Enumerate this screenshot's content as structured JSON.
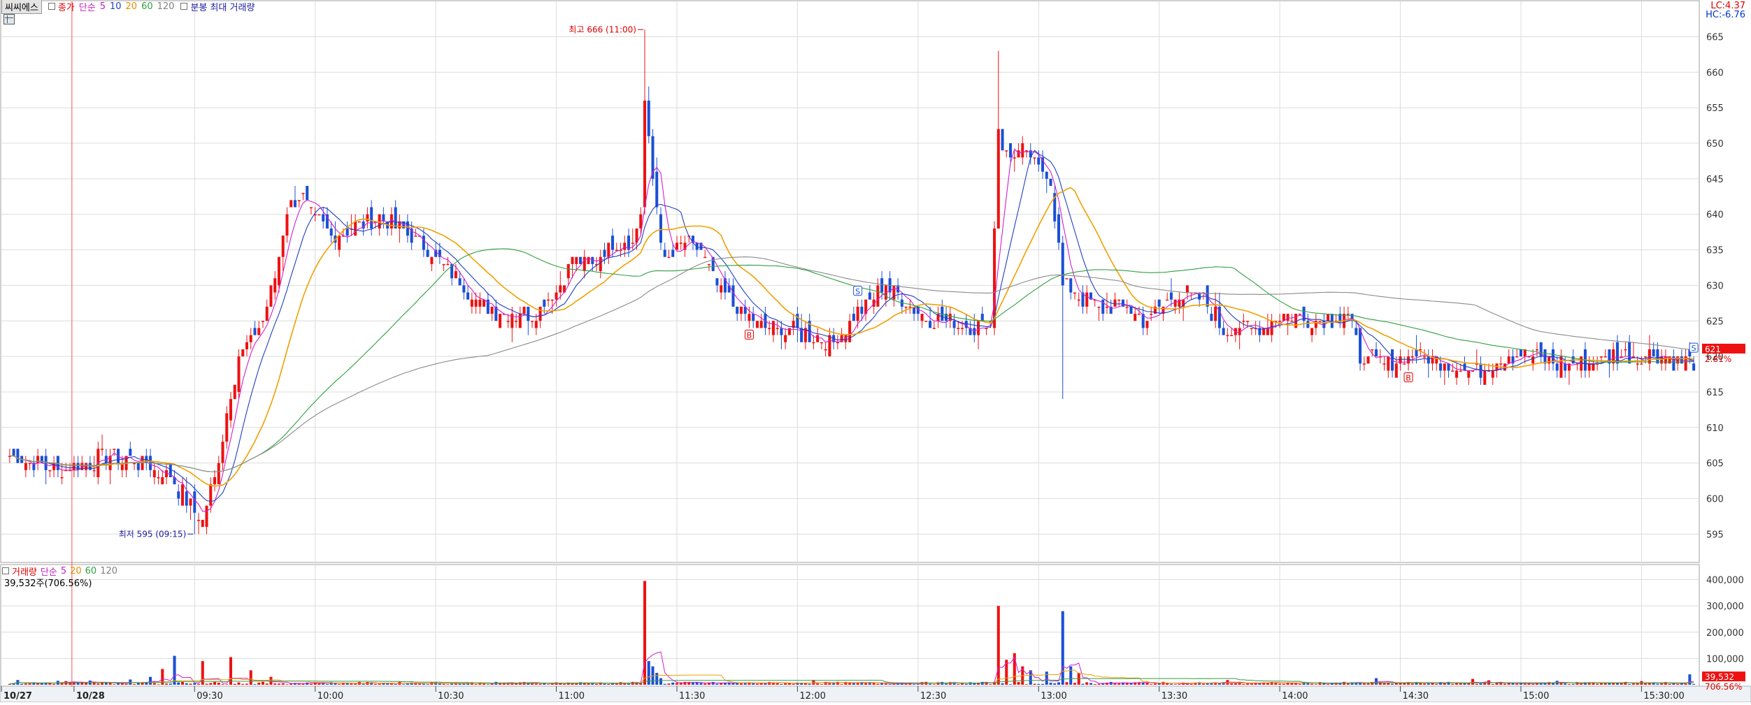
{
  "legend": {
    "stock_name": "씨씨에스",
    "price_label": "종가",
    "ma_type": "단순",
    "ma_periods": [
      "5",
      "10",
      "20",
      "60",
      "120"
    ],
    "extra": "분봉 최대 거래량"
  },
  "volume_legend": {
    "label": "거래량",
    "ma_type": "단순",
    "ma_periods": [
      "5",
      "20",
      "60",
      "120"
    ],
    "readout": "39,532주(706.56%)"
  },
  "corner": {
    "lc": "LC:4.37",
    "hc": "HC:-6.76"
  },
  "price_tag": {
    "value": "621",
    "pct": "2.81%"
  },
  "volume_tag": {
    "value": "39,532",
    "pct": "706.56%"
  },
  "annotations": {
    "high": "최고 666 (11:00)",
    "low": "최저 595 (09:15)"
  },
  "markers": {
    "buy": "B",
    "sell": "S"
  },
  "colors": {
    "up": "#ee1111",
    "down": "#1a4fd6",
    "ma5": "#d020d0",
    "ma10": "#2040c0",
    "ma20": "#f0a000",
    "ma60": "#30a040",
    "ma120": "#8a8a8a",
    "grid": "#dcdcdc"
  },
  "chart_data": {
    "type": "candlestick",
    "x_ticks": [
      "10/27",
      "10/28",
      "09:30",
      "10:00",
      "10:30",
      "11:00",
      "11:30",
      "12:00",
      "12:30",
      "13:00",
      "13:30",
      "14:00",
      "14:30",
      "15:00",
      "15:30:00"
    ],
    "price_axis": {
      "ylim": [
        591,
        668
      ],
      "ticks": [
        595,
        600,
        605,
        610,
        615,
        620,
        625,
        630,
        635,
        640,
        645,
        650,
        655,
        660,
        665
      ]
    },
    "volume_axis": {
      "ylim": [
        0,
        420000
      ],
      "ticks": [
        "100,000",
        "200,000",
        "300,000",
        "400,000"
      ]
    },
    "price_anchors": [
      [
        0,
        606
      ],
      [
        12,
        604
      ],
      [
        25,
        606
      ],
      [
        33,
        605
      ],
      [
        40,
        603
      ],
      [
        46,
        598
      ],
      [
        48,
        597
      ],
      [
        51,
        603
      ],
      [
        54,
        612
      ],
      [
        57,
        620
      ],
      [
        60,
        622
      ],
      [
        63,
        625
      ],
      [
        66,
        631
      ],
      [
        69,
        641
      ],
      [
        72,
        643
      ],
      [
        75,
        640
      ],
      [
        80,
        637
      ],
      [
        85,
        638
      ],
      [
        92,
        640
      ],
      [
        100,
        637
      ],
      [
        110,
        632
      ],
      [
        118,
        627
      ],
      [
        125,
        626
      ],
      [
        130,
        626
      ],
      [
        136,
        629
      ],
      [
        140,
        634
      ],
      [
        145,
        633
      ],
      [
        150,
        636
      ],
      [
        155,
        636
      ],
      [
        157,
        640
      ],
      [
        158,
        656
      ],
      [
        160,
        645
      ],
      [
        163,
        633
      ],
      [
        168,
        636
      ],
      [
        172,
        635
      ],
      [
        176,
        630
      ],
      [
        180,
        627
      ],
      [
        185,
        625
      ],
      [
        190,
        624
      ],
      [
        200,
        623
      ],
      [
        205,
        622
      ],
      [
        209,
        625
      ],
      [
        213,
        627
      ],
      [
        218,
        630
      ],
      [
        222,
        628
      ],
      [
        226,
        626
      ],
      [
        232,
        625
      ],
      [
        240,
        624
      ],
      [
        244,
        625
      ],
      [
        246,
        652
      ],
      [
        248,
        648
      ],
      [
        251,
        649
      ],
      [
        254,
        648
      ],
      [
        257,
        646
      ],
      [
        259,
        645
      ],
      [
        262,
        630
      ],
      [
        265,
        629
      ],
      [
        270,
        627
      ],
      [
        278,
        627
      ],
      [
        283,
        625
      ],
      [
        290,
        629
      ],
      [
        297,
        628
      ],
      [
        302,
        624
      ],
      [
        312,
        624
      ],
      [
        318,
        626
      ],
      [
        326,
        625
      ],
      [
        333,
        626
      ],
      [
        336,
        620
      ],
      [
        342,
        619
      ],
      [
        350,
        620
      ],
      [
        358,
        619
      ],
      [
        365,
        618
      ],
      [
        372,
        620
      ],
      [
        380,
        620
      ],
      [
        385,
        619
      ],
      [
        390,
        619
      ],
      [
        398,
        620
      ],
      [
        405,
        620
      ],
      [
        410,
        620
      ],
      [
        419,
        619
      ]
    ],
    "volume_spikes": [
      [
        2,
        18000
      ],
      [
        12,
        15000
      ],
      [
        14,
        14000
      ],
      [
        20,
        16000
      ],
      [
        30,
        20000
      ],
      [
        35,
        30000
      ],
      [
        38,
        60000
      ],
      [
        41,
        110000
      ],
      [
        48,
        90000
      ],
      [
        55,
        105000
      ],
      [
        60,
        55000
      ],
      [
        65,
        30000
      ],
      [
        158,
        395000
      ],
      [
        159,
        90000
      ],
      [
        160,
        70000
      ],
      [
        161,
        45000
      ],
      [
        162,
        25000
      ],
      [
        200,
        18000
      ],
      [
        246,
        300000
      ],
      [
        248,
        95000
      ],
      [
        250,
        120000
      ],
      [
        252,
        70000
      ],
      [
        254,
        55000
      ],
      [
        258,
        50000
      ],
      [
        262,
        280000
      ],
      [
        264,
        70000
      ],
      [
        266,
        45000
      ],
      [
        303,
        18000
      ],
      [
        340,
        25000
      ],
      [
        364,
        22000
      ],
      [
        368,
        17000
      ],
      [
        385,
        15000
      ],
      [
        406,
        14000
      ],
      [
        418,
        39532
      ]
    ],
    "bar_count": 420,
    "candle_seed": 7,
    "ma_periods": [
      5,
      10,
      20,
      60,
      120
    ],
    "high": {
      "value": 666,
      "time": "11:00"
    },
    "low": {
      "value": 595,
      "time": "09:15"
    },
    "last": 621,
    "last_volume": 39532
  }
}
